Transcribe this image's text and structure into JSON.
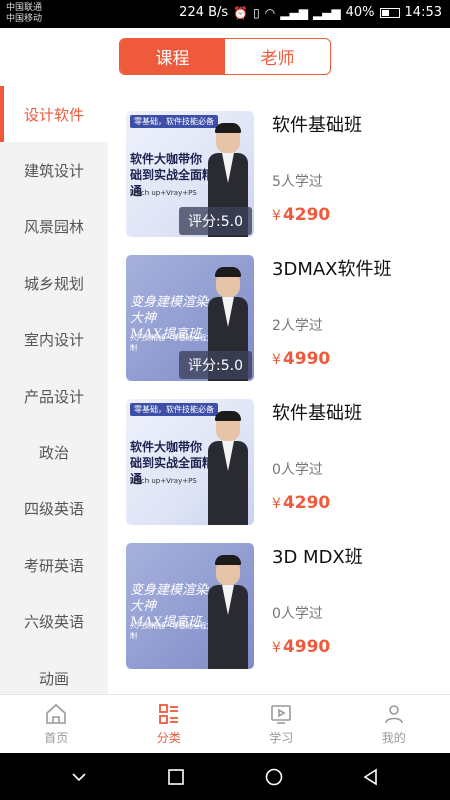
{
  "status_bar": {
    "carrier1": "中国联通",
    "carrier2": "中国移动",
    "speed": "224 B/s",
    "battery": "40%",
    "time": "14:53"
  },
  "segment": {
    "options": [
      "课程",
      "老师"
    ],
    "selected": "课程"
  },
  "categories": [
    {
      "label": "设计软件",
      "active": true
    },
    {
      "label": "建筑设计",
      "active": false
    },
    {
      "label": "风景园林",
      "active": false
    },
    {
      "label": "城乡规划",
      "active": false
    },
    {
      "label": "室内设计",
      "active": false
    },
    {
      "label": "产品设计",
      "active": false
    },
    {
      "label": "政治",
      "active": false
    },
    {
      "label": "四级英语",
      "active": false
    },
    {
      "label": "考研英语",
      "active": false
    },
    {
      "label": "六级英语",
      "active": false
    },
    {
      "label": "动画",
      "active": false
    }
  ],
  "courses": [
    {
      "title": "软件基础班",
      "students": "5人学过",
      "currency": "¥",
      "price": "4290",
      "rating": "评分:5.0",
      "thumb_tag": "零基础，软件技能必备",
      "thumb_headline": "软件大咖带你\n础到实战全面精通",
      "thumb_sub": "ketch up+Vray+PS",
      "thumb_style": "t1"
    },
    {
      "title": "3DMAX软件班",
      "students": "2人学过",
      "currency": "¥",
      "price": "4990",
      "rating": "评分:5.0",
      "thumb_tag": "",
      "thumb_headline": "变身建模渲染大神\nMAX提高班",
      "thumb_sub": "入门到精通 · 零基础全程定制",
      "thumb_style": "t2"
    },
    {
      "title": "软件基础班",
      "students": "0人学过",
      "currency": "¥",
      "price": "4290",
      "rating": "",
      "thumb_tag": "零基础，软件技能必备",
      "thumb_headline": "软件大咖带你\n础到实战全面精通",
      "thumb_sub": "ketch up+Vray+PS",
      "thumb_style": "t1"
    },
    {
      "title": "3D MDX班",
      "students": "0人学过",
      "currency": "¥",
      "price": "4990",
      "rating": "",
      "thumb_tag": "",
      "thumb_headline": "变身建模渲染大神\nMAX提高班",
      "thumb_sub": "入门到精通 · 零基础全程定制",
      "thumb_style": "t2"
    }
  ],
  "tabbar": [
    {
      "label": "首页",
      "icon": "home-icon",
      "active": false
    },
    {
      "label": "分类",
      "icon": "category-icon",
      "active": true
    },
    {
      "label": "学习",
      "icon": "play-icon",
      "active": false
    },
    {
      "label": "我的",
      "icon": "person-icon",
      "active": false
    }
  ],
  "colors": {
    "accent": "#ef5a3c",
    "sidebar_bg": "#f3f3f3"
  }
}
